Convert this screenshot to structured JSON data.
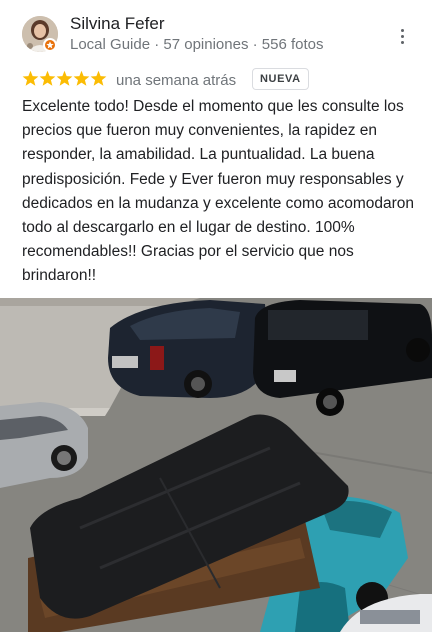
{
  "reviewer": {
    "name": "Silvina Fefer",
    "meta": "Local Guide · 57 opiniones · 556 fotos",
    "avatar_icon": "reviewer-avatar",
    "badge_icon": "local-guide-star-icon"
  },
  "review": {
    "rating": 5,
    "rating_max": 5,
    "time": "una semana atrás",
    "badge": "NUEVA",
    "text": "Excelente todo! Desde el momento que les consulte los precios que fueron muy convenientes, la rapidez en responder, la amabilidad. La puntualidad. La buena predisposición. Fede y Ever fueron muy responsables y dedicados en la mudanza y excelente como acomodaron todo al descargarlo en el lugar de destino. 100% recomendables!! Gracias por el servicio que nos brindaron!!"
  },
  "colors": {
    "star": "#fbbc04",
    "badge_orange": "#e8710a",
    "secondary_text": "#70757a"
  },
  "icons": {
    "more": "more-vert-icon",
    "star": "star-icon"
  }
}
